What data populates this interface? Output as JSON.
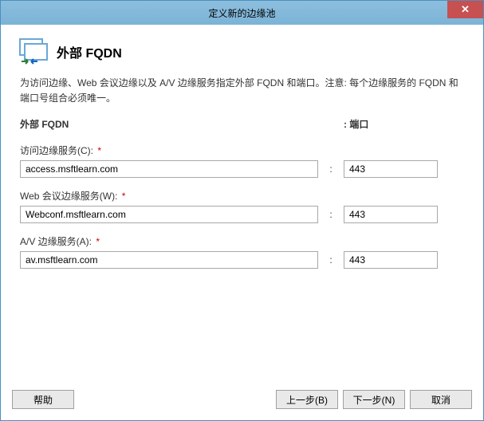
{
  "window": {
    "title": "定义新的边缘池",
    "close_label": "✕"
  },
  "header": {
    "title": "外部 FQDN"
  },
  "description": "为访问边缘、Web 会议边缘以及 A/V 边缘服务指定外部 FQDN 和端口。注意: 每个边缘服务的 FQDN 和端口号组合必须唯一。",
  "columns": {
    "fqdn_label": "外部 FQDN",
    "port_label": ": 端口"
  },
  "fields": {
    "access": {
      "label": "访问边缘服务(C):",
      "required_marker": "*",
      "fqdn": "access.msftlearn.com",
      "port": "443"
    },
    "webconf": {
      "label": "Web 会议边缘服务(W):",
      "required_marker": "*",
      "fqdn": "Webconf.msftlearn.com",
      "port": "443"
    },
    "av": {
      "label": "A/V 边缘服务(A):",
      "required_marker": "*",
      "fqdn": "av.msftlearn.com",
      "port": "443"
    },
    "colon": ":"
  },
  "buttons": {
    "help": "帮助",
    "back": "上一步(B)",
    "next": "下一步(N)",
    "cancel": "取消"
  }
}
